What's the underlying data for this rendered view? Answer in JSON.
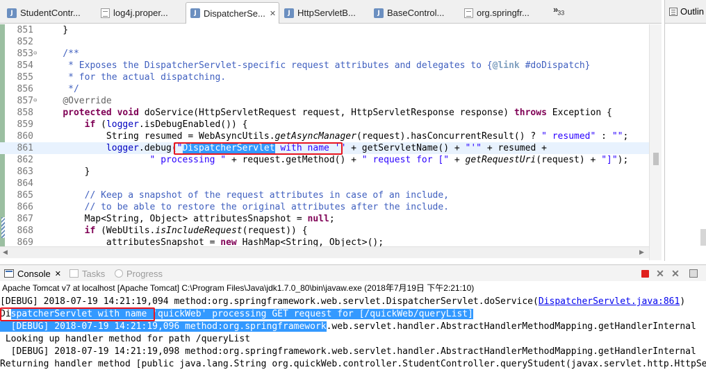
{
  "editor_tabs": [
    {
      "label": "StudentContr...",
      "icon": "java-class-icon"
    },
    {
      "label": "log4j.proper...",
      "icon": "properties-file-icon"
    },
    {
      "label": "DispatcherSe...",
      "icon": "java-class-icon",
      "active": true,
      "close": "✕"
    },
    {
      "label": "HttpServletB...",
      "icon": "java-class-icon"
    },
    {
      "label": "BaseControl...",
      "icon": "java-class-icon"
    },
    {
      "label": "org.springfr...",
      "icon": "properties-file-icon"
    }
  ],
  "tab_overflow": {
    "glyph": "»",
    "count": "33"
  },
  "outline": {
    "label": "Outlin"
  },
  "code_lines": [
    {
      "n": "851",
      "t": "    }"
    },
    {
      "n": "852",
      "t": ""
    },
    {
      "n": "853",
      "fold": "⊖",
      "t": "    /**"
    },
    {
      "n": "854",
      "t": "     * Exposes the DispatcherServlet-specific request attributes and delegates to {@link #doDispatch}"
    },
    {
      "n": "855",
      "t": "     * for the actual dispatching."
    },
    {
      "n": "856",
      "t": "     */"
    },
    {
      "n": "857",
      "fold": "⊖",
      "t": "    @Override"
    },
    {
      "n": "858",
      "t": "    protected void doService(HttpServletRequest request, HttpServletResponse response) throws Exception {"
    },
    {
      "n": "859",
      "t": "        if (logger.isDebugEnabled()) {"
    },
    {
      "n": "860",
      "t": "            String resumed = WebAsyncUtils.getAsyncManager(request).hasConcurrentResult() ? \" resumed\" : \"\";"
    },
    {
      "n": "861",
      "t": "            logger.debug(\"DispatcherServlet with name '\" + getServletName() + \"'\" + resumed +",
      "current": true
    },
    {
      "n": "862",
      "t": "                    \" processing \" + request.getMethod() + \" request for [\" + getRequestUri(request) + \"]\");"
    },
    {
      "n": "863",
      "t": "        }"
    },
    {
      "n": "864",
      "t": ""
    },
    {
      "n": "865",
      "t": "        // Keep a snapshot of the request attributes in case of an include,"
    },
    {
      "n": "866",
      "t": "        // to be able to restore the original attributes after the include."
    },
    {
      "n": "867",
      "t": "        Map<String, Object> attributesSnapshot = null;"
    },
    {
      "n": "868",
      "t": "        if (WebUtils.isIncludeRequest(request)) {"
    },
    {
      "n": "869",
      "t": "            attributesSnapshot = new HashMap<String, Object>();"
    }
  ],
  "console": {
    "tabs": [
      {
        "label": "Console",
        "close": "✕"
      },
      {
        "label": "Tasks"
      },
      {
        "label": "Progress"
      }
    ],
    "launch": "Apache Tomcat v7 at localhost [Apache Tomcat] C:\\Program Files\\Java\\jdk1.7.0_80\\bin\\javaw.exe (2018年7月19日 下午2:21:10)",
    "lines": [
      {
        "pre": "[DEBUG] 2018-07-19 14:21:19,094 method:org.springframework.web.servlet.DispatcherServlet.doService(",
        "link": "DispatcherServlet.java:861",
        "post": ")"
      },
      {
        "pre": "Di",
        "sel": "spatcherServlet with name 'quickWeb' processing GET request for [/quickWeb/queryList]",
        "post": ""
      },
      {
        "pre": "",
        "sel": "  [DEBUG] 2018-07-19 14:21:19,096 method:org.springframework",
        "post": ".web.servlet.handler.AbstractHandlerMethodMapping.getHandlerInternal"
      },
      {
        "pre": " Looking up handler method for path /queryList",
        "post": ""
      },
      {
        "pre": "  [DEBUG] 2018-07-19 14:21:19,098 method:org.springframework.web.servlet.handler.AbstractHandlerMethodMapping.getHandlerInternal",
        "post": ""
      },
      {
        "pre": "Returning handler method [public java.lang.String org.quickWeb.controller.StudentController.queryStudent(javax.servlet.http.HttpServletRequest",
        "post": ""
      }
    ]
  },
  "colors": {
    "keyword": "#7f0055",
    "comment": "#3f5fbf",
    "string": "#2a00ff",
    "selection": "#3399ff",
    "mark": "#e8141e"
  }
}
